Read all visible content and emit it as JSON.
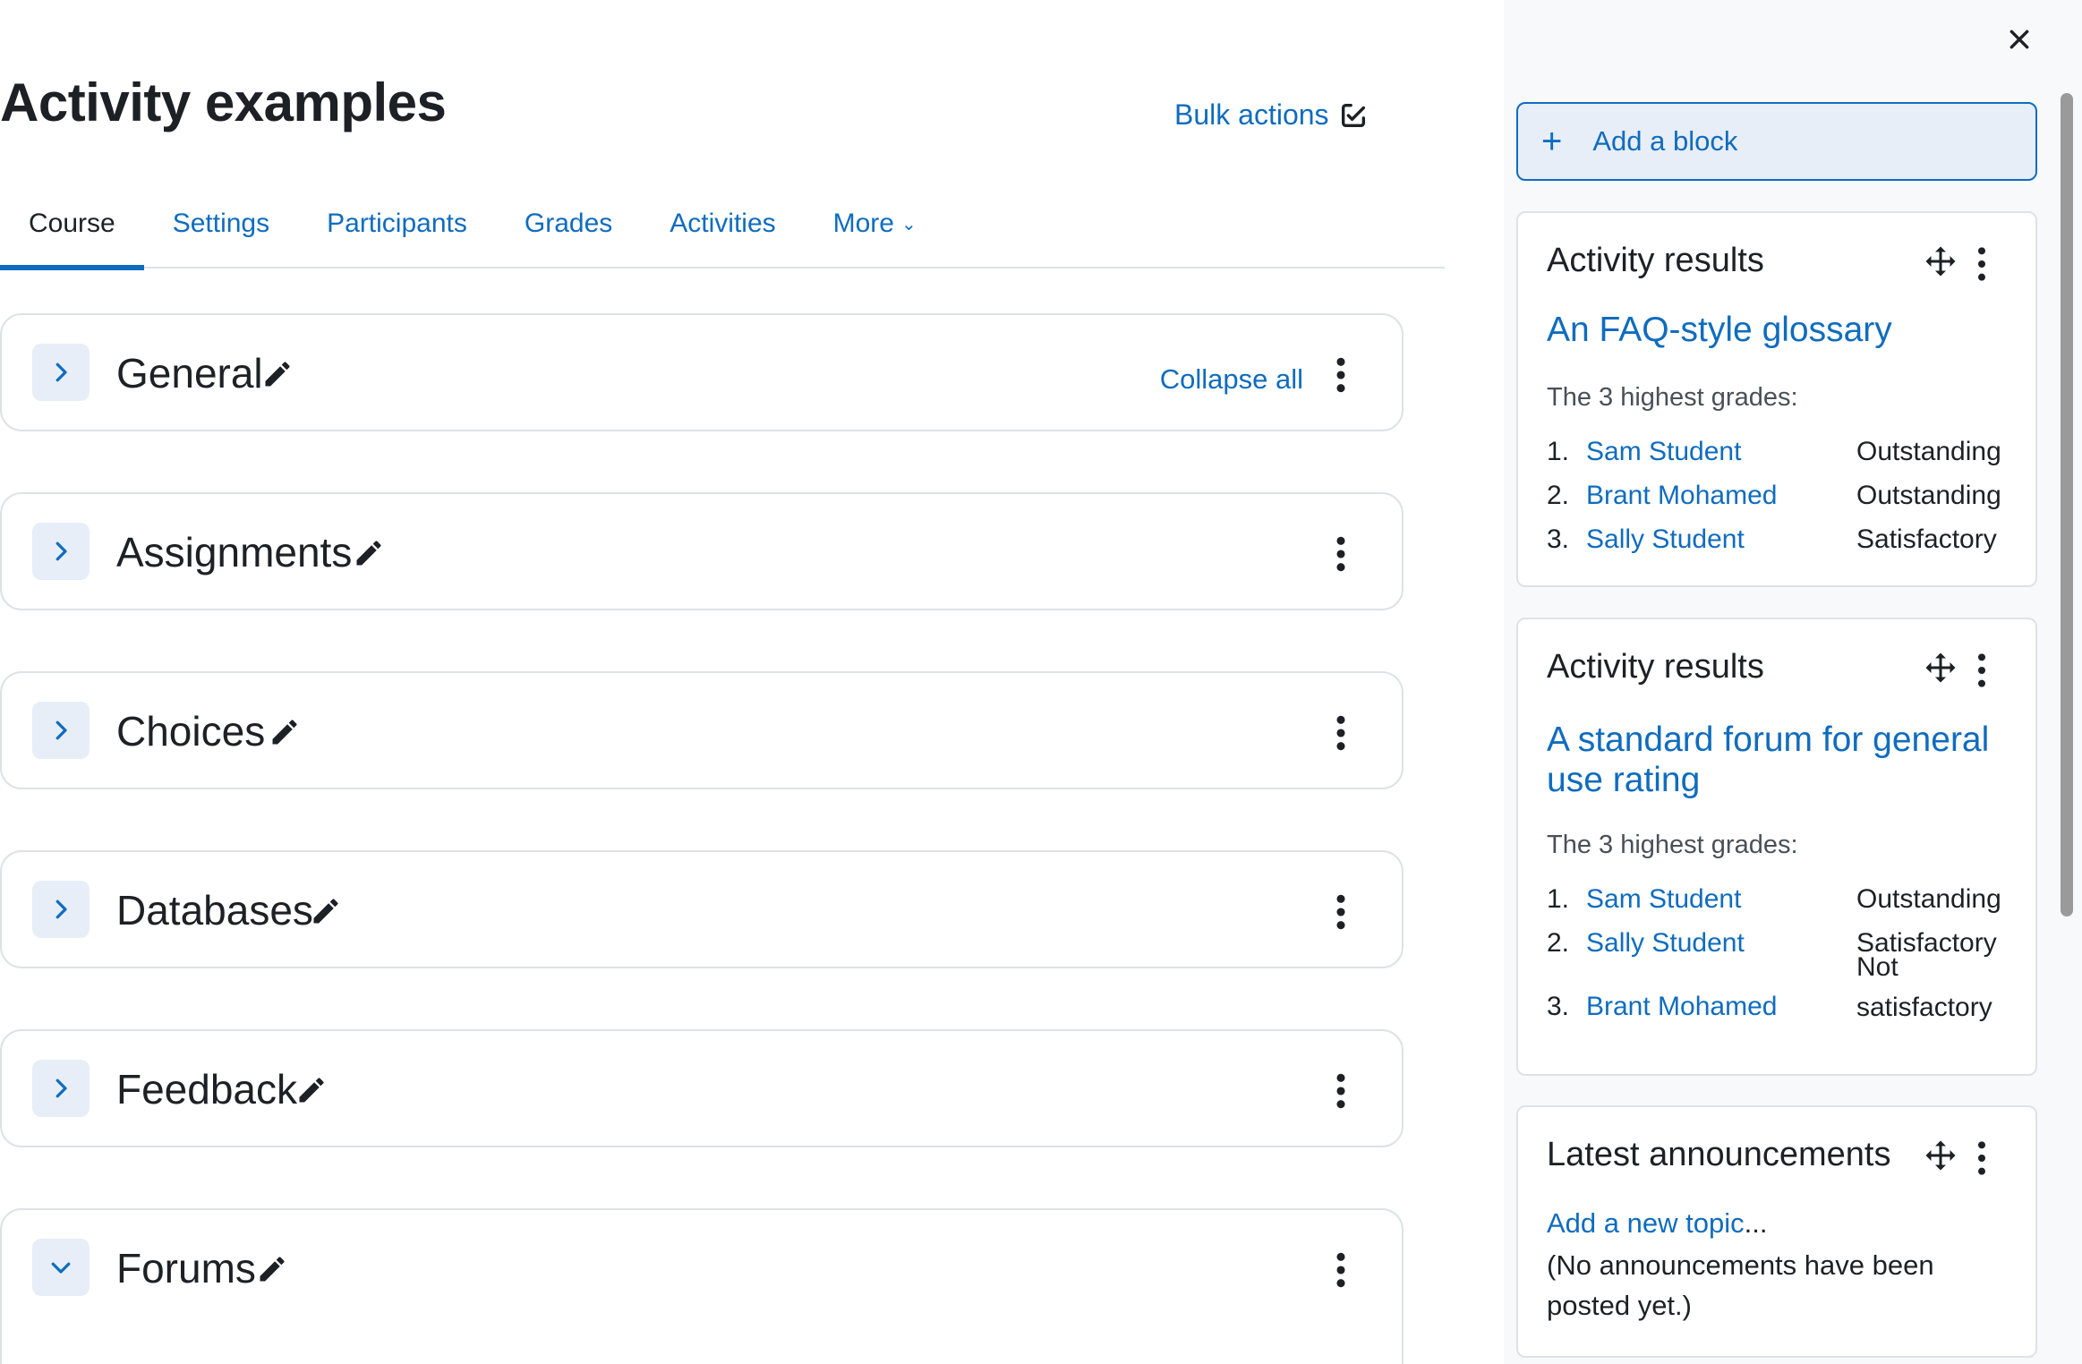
{
  "header": {
    "title": "Activity examples",
    "bulk_actions_label": "Bulk actions"
  },
  "tabs": [
    {
      "label": "Course",
      "active": true
    },
    {
      "label": "Settings"
    },
    {
      "label": "Participants"
    },
    {
      "label": "Grades"
    },
    {
      "label": "Activities"
    },
    {
      "label": "More"
    }
  ],
  "sections": [
    {
      "name": "General",
      "expanded": false
    },
    {
      "name": "Assignments",
      "expanded": false
    },
    {
      "name": "Choices",
      "expanded": false
    },
    {
      "name": "Databases",
      "expanded": false
    },
    {
      "name": "Feedback",
      "expanded": false
    },
    {
      "name": "Forums",
      "expanded": true
    }
  ],
  "collapse_all_label": "Collapse all",
  "drawer": {
    "add_block_label": "Add a block",
    "blocks": [
      {
        "title": "Activity results",
        "activity": "An FAQ-style glossary",
        "grades_label": "The 3 highest grades:",
        "grades": [
          {
            "rank": "1.",
            "student": "Sam Student",
            "grade": "Outstanding"
          },
          {
            "rank": "2.",
            "student": "Brant Mohamed",
            "grade": "Outstanding"
          },
          {
            "rank": "3.",
            "student": "Sally Student",
            "grade": "Satisfactory"
          }
        ]
      },
      {
        "title": "Activity results",
        "activity": "A standard forum for general use rating",
        "grades_label": "The 3 highest grades:",
        "grades": [
          {
            "rank": "1.",
            "student": "Sam Student",
            "grade": "Outstanding"
          },
          {
            "rank": "2.",
            "student": "Sally Student",
            "grade": "Satisfactory"
          },
          {
            "rank": "3.",
            "student": "Brant Mohamed",
            "grade": "Not satisfactory"
          }
        ]
      },
      {
        "title": "Latest announcements",
        "add_topic": "Add a new topic",
        "add_topic_suffix": "...",
        "no_announcements": "(No announcements have been posted yet.)"
      }
    ]
  },
  "colors": {
    "link": "#0f6cbf",
    "text": "#1d2125",
    "border": "#dee2e6",
    "drawer_bg": "#f8f9fa"
  }
}
